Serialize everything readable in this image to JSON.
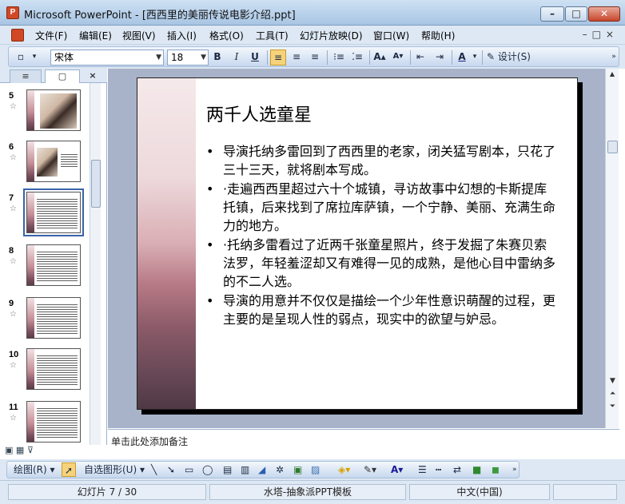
{
  "window": {
    "title": "Microsoft PowerPoint - [西西里的美丽传说电影介绍.ppt]"
  },
  "menu": [
    "文件(F)",
    "编辑(E)",
    "视图(V)",
    "插入(I)",
    "格式(O)",
    "工具(T)",
    "幻灯片放映(D)",
    "窗口(W)",
    "帮助(H)"
  ],
  "toolbar": {
    "font": "宋体",
    "size": "18",
    "bold": "B",
    "italic": "I",
    "underline": "U",
    "design": "设计(S)"
  },
  "panel": {
    "outline_tab": "≡",
    "slides_tab": "▢",
    "close": "×"
  },
  "thumbnails": [
    {
      "num": "5",
      "kind": "photo"
    },
    {
      "num": "6",
      "kind": "photo-text"
    },
    {
      "num": "7",
      "kind": "text",
      "selected": true
    },
    {
      "num": "8",
      "kind": "text"
    },
    {
      "num": "9",
      "kind": "text"
    },
    {
      "num": "10",
      "kind": "text"
    },
    {
      "num": "11",
      "kind": "text"
    }
  ],
  "slide": {
    "title": "两千人选童星",
    "bullets": [
      "导演托纳多雷回到了西西里的老家，闭关猛写剧本，只花了三十三天，就将剧本写成。",
      "·走遍西西里超过六十个城镇，寻访故事中幻想的卡斯提库托镇，后来找到了席拉库萨镇，一个宁静、美丽、充满生命力的地方。",
      "·托纳多雷看过了近两千张童星照片，终于发掘了朱赛贝索法罗，年轻羞涩却又有难得一见的成熟，是他心目中雷纳多的不二人选。",
      "导演的用意并不仅仅是描绘一个少年性意识萌醒的过程，更主要的是呈现人性的弱点，现实中的欲望与妒忌。"
    ]
  },
  "notes": {
    "placeholder": "单击此处添加备注"
  },
  "drawing": {
    "draw": "绘图(R)",
    "autoshapes": "自选图形(U)"
  },
  "status": {
    "slide": "幻灯片 7 / 30",
    "template": "水塔-抽象派PPT模板",
    "language": "中文(中国)"
  }
}
